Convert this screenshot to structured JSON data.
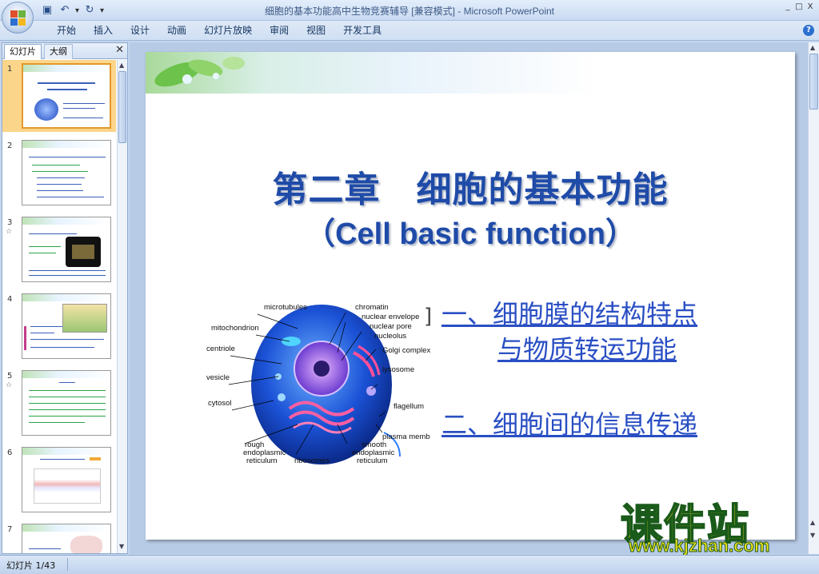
{
  "window": {
    "title": "细胞的基本功能高中生物竞赛辅导 [兼容模式] - Microsoft PowerPoint",
    "min_label": "_",
    "max_label": "□",
    "close_label": "X"
  },
  "ribbon": {
    "tabs": [
      "开始",
      "插入",
      "设计",
      "动画",
      "幻灯片放映",
      "审阅",
      "视图",
      "开发工具"
    ],
    "help_label": "?"
  },
  "left_panel": {
    "tabs": {
      "slides": "幻灯片",
      "outline": "大纲"
    },
    "close_label": "✕",
    "thumbnails": [
      {
        "num": "1",
        "star": ""
      },
      {
        "num": "2",
        "star": ""
      },
      {
        "num": "3",
        "star": "☆"
      },
      {
        "num": "4",
        "star": ""
      },
      {
        "num": "5",
        "star": "☆"
      },
      {
        "num": "6",
        "star": ""
      },
      {
        "num": "7",
        "star": ""
      }
    ]
  },
  "slide": {
    "title": "第二章　细胞的基本功能",
    "subtitle": "（Cell basic function）",
    "link1_line1": "一、细胞膜的结构特点",
    "link1_line2": "与物质转运功能",
    "link2": "二、细胞间的信息传递",
    "cell_labels": {
      "microtubules": "microtubules",
      "mitochondrion": "mitochondrion",
      "centriole": "centriole",
      "vesicle": "vesicle",
      "cytosol": "cytosol",
      "chromatin": "chromatin",
      "nuclear_envelope": "nuclear envelope",
      "nuclear_pore": "nuclear pore",
      "nucleolus": "nucleolus",
      "golgi": "Golgi complex",
      "lysosome": "lysosome",
      "flagellum": "flagellum",
      "plasma": "plasma memb",
      "rough1": "rough",
      "rough2": "endoplasmic",
      "rough3": "reticulum",
      "ribosomes": "ribosomes",
      "smooth1": "smooth",
      "smooth2": "endoplasmic",
      "smooth3": "reticulum"
    }
  },
  "watermark": {
    "line1": "课件站",
    "line2": "www.kjzhan.com"
  },
  "status": {
    "slide_info": "幻灯片 1/43"
  }
}
